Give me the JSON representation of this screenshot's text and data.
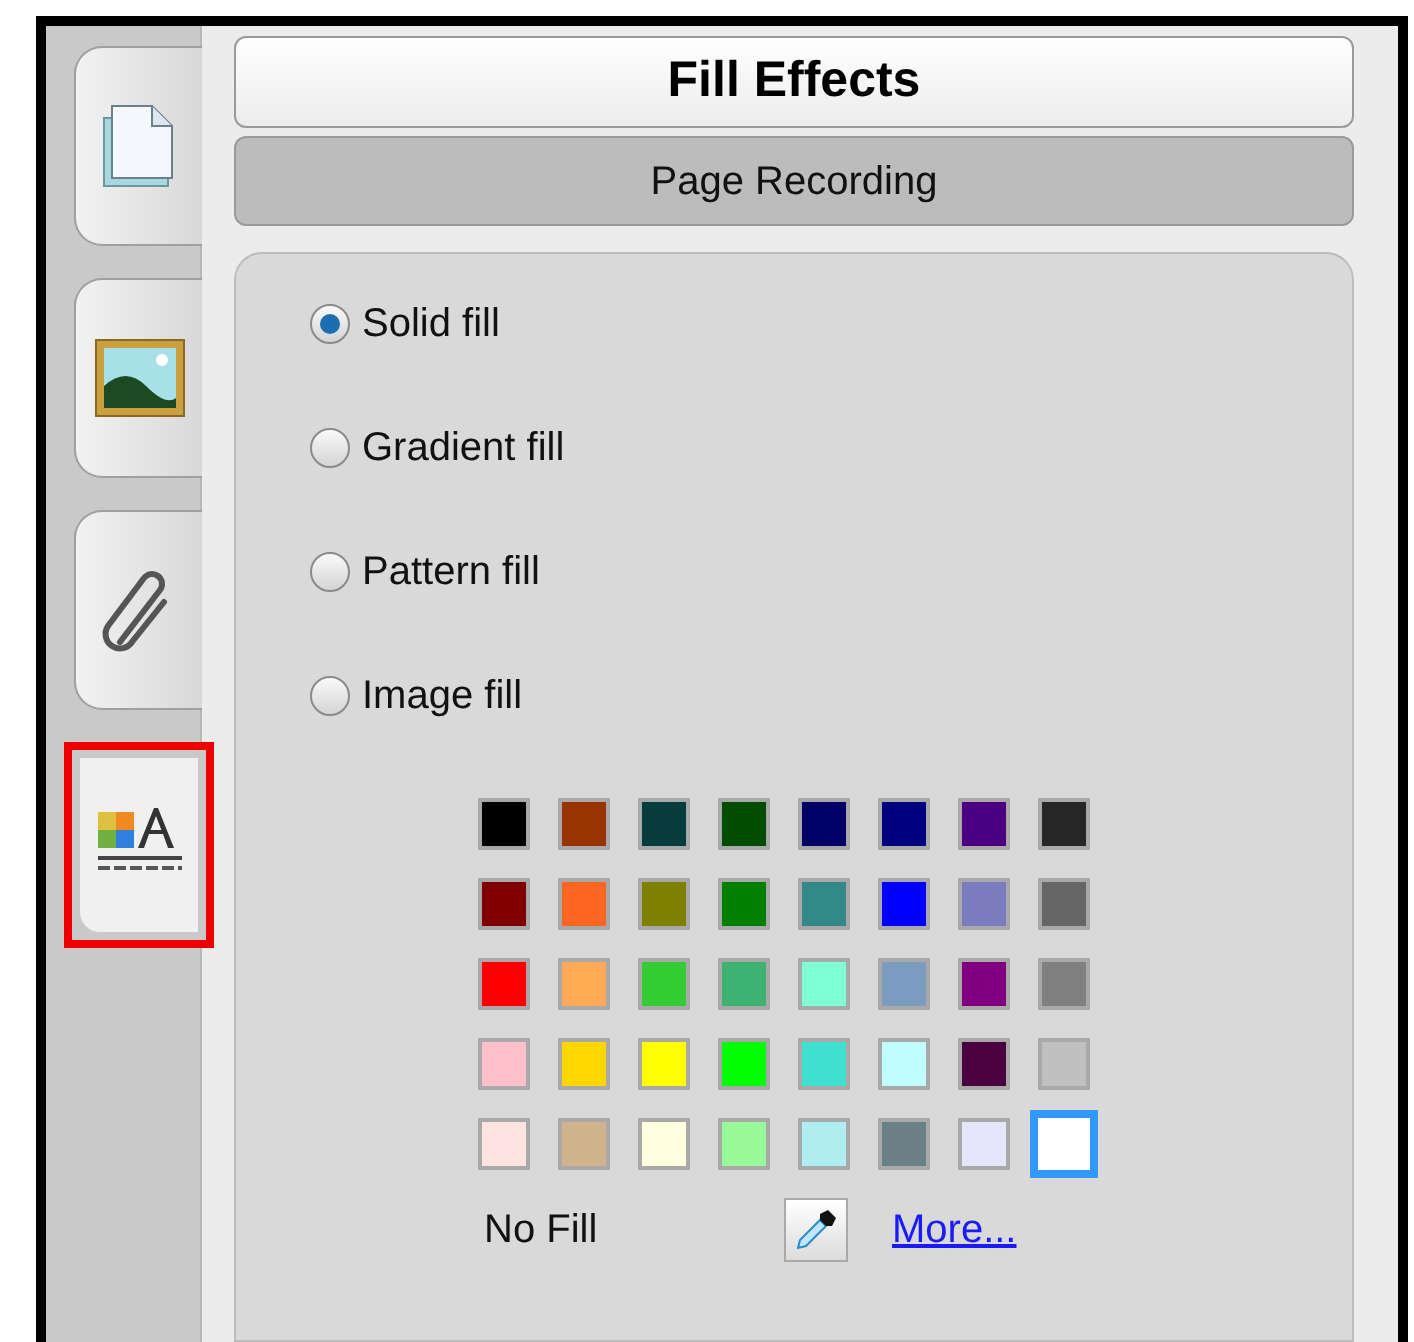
{
  "sidebar": {
    "tabs": [
      {
        "kind": "pages",
        "selected": false
      },
      {
        "kind": "gallery",
        "selected": false
      },
      {
        "kind": "attachments",
        "selected": false
      },
      {
        "kind": "properties",
        "selected": true
      }
    ]
  },
  "header": {
    "title": "Fill Effects",
    "subtitle_button": "Page Recording"
  },
  "fill_options": [
    {
      "label": "Solid fill",
      "selected": true
    },
    {
      "label": "Gradient fill",
      "selected": false
    },
    {
      "label": "Pattern fill",
      "selected": false
    },
    {
      "label": "Image fill",
      "selected": false
    }
  ],
  "palette": {
    "swatches": [
      {
        "color": "#000000",
        "selected": false
      },
      {
        "color": "#993300",
        "selected": false
      },
      {
        "color": "#063c3c",
        "selected": false
      },
      {
        "color": "#004d00",
        "selected": false
      },
      {
        "color": "#000066",
        "selected": false
      },
      {
        "color": "#000080",
        "selected": false
      },
      {
        "color": "#4b0082",
        "selected": false
      },
      {
        "color": "#262626",
        "selected": false
      },
      {
        "color": "#800000",
        "selected": false
      },
      {
        "color": "#ff6622",
        "selected": false
      },
      {
        "color": "#808000",
        "selected": false
      },
      {
        "color": "#008000",
        "selected": false
      },
      {
        "color": "#338888",
        "selected": false
      },
      {
        "color": "#0000ff",
        "selected": false
      },
      {
        "color": "#7b7bc0",
        "selected": false
      },
      {
        "color": "#666666",
        "selected": false
      },
      {
        "color": "#ff0000",
        "selected": false
      },
      {
        "color": "#ffaa55",
        "selected": false
      },
      {
        "color": "#33cc33",
        "selected": false
      },
      {
        "color": "#3cb371",
        "selected": false
      },
      {
        "color": "#7fffd4",
        "selected": false
      },
      {
        "color": "#7a9cc0",
        "selected": false
      },
      {
        "color": "#800080",
        "selected": false
      },
      {
        "color": "#808080",
        "selected": false
      },
      {
        "color": "#ffc0cb",
        "selected": false
      },
      {
        "color": "#ffd700",
        "selected": false
      },
      {
        "color": "#ffff00",
        "selected": false
      },
      {
        "color": "#00ff00",
        "selected": false
      },
      {
        "color": "#40e0d0",
        "selected": false
      },
      {
        "color": "#c0ffff",
        "selected": false
      },
      {
        "color": "#4b0040",
        "selected": false
      },
      {
        "color": "#c0c0c0",
        "selected": false
      },
      {
        "color": "#ffe4e1",
        "selected": false
      },
      {
        "color": "#d2b48c",
        "selected": false
      },
      {
        "color": "#ffffe0",
        "selected": false
      },
      {
        "color": "#98fb98",
        "selected": false
      },
      {
        "color": "#afeeee",
        "selected": false
      },
      {
        "color": "#6a7f86",
        "selected": false
      },
      {
        "color": "#e6e6fa",
        "selected": false
      },
      {
        "color": "#ffffff",
        "selected": true
      }
    ],
    "no_fill": "No Fill",
    "more_link": "More..."
  }
}
